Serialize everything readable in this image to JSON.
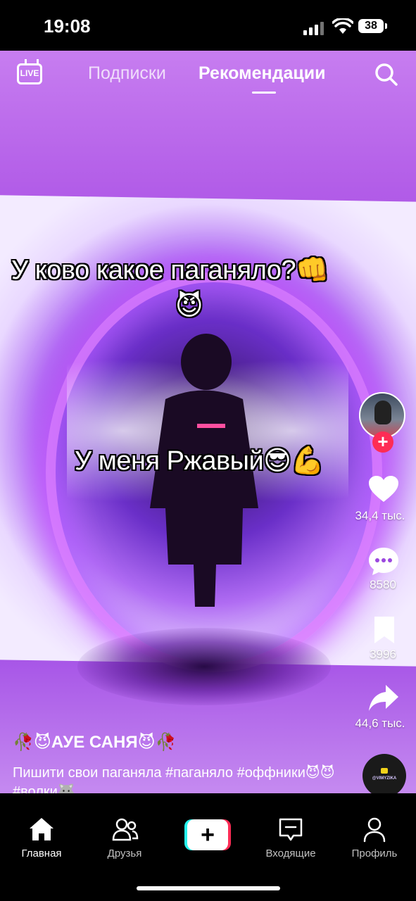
{
  "status_bar": {
    "time": "19:08",
    "battery": "38"
  },
  "top_nav": {
    "live_label": "LIVE",
    "tabs": [
      {
        "label": "Подписки",
        "active": false
      },
      {
        "label": "Рекомендации",
        "active": true
      }
    ]
  },
  "video": {
    "overlay_text_1": "У ково какое паганяло?👊",
    "overlay_text_1b": "😈",
    "overlay_text_2": "У меня Ржавый😎💪"
  },
  "actions": {
    "likes": "34,4 тыс.",
    "comments": "8580",
    "saves": "3996",
    "shares": "44,6 тыс."
  },
  "post": {
    "author": "🥀😈АУЕ САНЯ😈🥀",
    "description": "Пишити свои паганяла #паганяло #оффники😈😈 #волки🐺",
    "music_label": "@VIMYZIKA"
  },
  "bottom_nav": {
    "home": "Главная",
    "friends": "Друзья",
    "create": "+",
    "inbox": "Входящие",
    "profile": "Профиль"
  },
  "colors": {
    "accent_red": "#fe2c55",
    "accent_cyan": "#25f4ee"
  },
  "icons": [
    "live-icon",
    "search-icon",
    "heart-icon",
    "comment-icon",
    "bookmark-icon",
    "share-icon",
    "home-icon",
    "friends-icon",
    "inbox-icon",
    "profile-icon"
  ]
}
